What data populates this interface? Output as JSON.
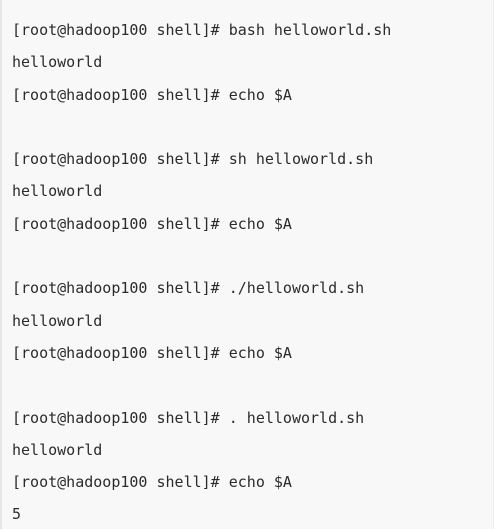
{
  "terminal": {
    "lines": [
      "[root@hadoop100 shell]# bash helloworld.sh",
      "helloworld",
      "[root@hadoop100 shell]# echo $A",
      "",
      "[root@hadoop100 shell]# sh helloworld.sh",
      "helloworld",
      "[root@hadoop100 shell]# echo $A",
      "",
      "[root@hadoop100 shell]# ./helloworld.sh",
      "helloworld",
      "[root@hadoop100 shell]# echo $A",
      "",
      "[root@hadoop100 shell]# . helloworld.sh",
      "helloworld",
      "[root@hadoop100 shell]# echo $A",
      "5"
    ]
  }
}
